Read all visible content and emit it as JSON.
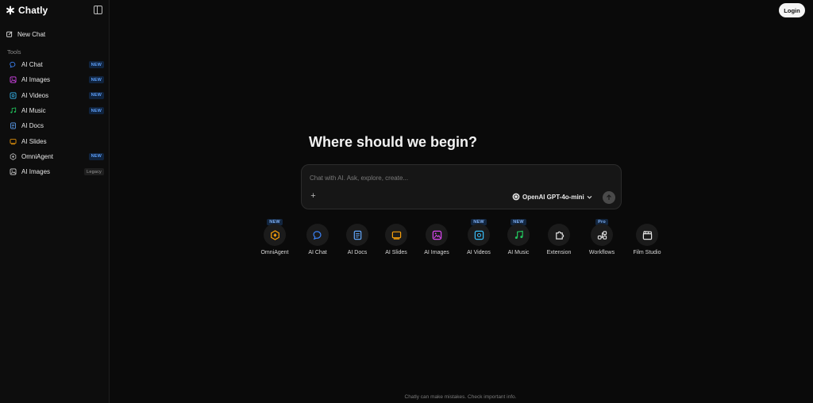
{
  "brand": {
    "name": "Chatly"
  },
  "sidebar": {
    "new_chat": "New Chat",
    "tools_heading": "Tools",
    "items": [
      {
        "label": "AI Chat",
        "badge": "NEW",
        "icon": "chat-bubble-icon",
        "color": "#3b82f6"
      },
      {
        "label": "AI Images",
        "badge": "NEW",
        "icon": "image-icon",
        "color": "#d946ef"
      },
      {
        "label": "AI Videos",
        "badge": "NEW",
        "icon": "video-icon",
        "color": "#38bdf8"
      },
      {
        "label": "AI Music",
        "badge": "NEW",
        "icon": "music-icon",
        "color": "#22c55e"
      },
      {
        "label": "AI Docs",
        "badge": "",
        "icon": "document-icon",
        "color": "#60a5fa"
      },
      {
        "label": "AI Slides",
        "badge": "",
        "icon": "slides-icon",
        "color": "#f59e0b"
      },
      {
        "label": "OmniAgent",
        "badge": "NEW",
        "icon": "omniagent-icon",
        "color": "#bdbdbd"
      },
      {
        "label": "AI Images",
        "badge": "Legacy",
        "icon": "image-legacy-icon",
        "color": "#cfcfcf"
      }
    ]
  },
  "header": {
    "login": "Login"
  },
  "main": {
    "heading": "Where should we begin?",
    "input_placeholder": "Chat with AI. Ask, explore, create...",
    "model": "OpenAI GPT-4o-mini"
  },
  "quick_actions": [
    {
      "label": "OmniAgent",
      "badge": "NEW",
      "icon": "omniagent-icon",
      "color": "#f59e0b"
    },
    {
      "label": "AI Chat",
      "badge": "",
      "icon": "chat-bubble-icon",
      "color": "#3b82f6"
    },
    {
      "label": "AI Docs",
      "badge": "",
      "icon": "document-icon",
      "color": "#60a5fa"
    },
    {
      "label": "AI Slides",
      "badge": "",
      "icon": "slides-icon",
      "color": "#f59e0b"
    },
    {
      "label": "AI Images",
      "badge": "",
      "icon": "image-icon",
      "color": "#d946ef"
    },
    {
      "label": "AI Videos",
      "badge": "NEW",
      "icon": "video-icon",
      "color": "#38bdf8"
    },
    {
      "label": "AI Music",
      "badge": "NEW",
      "icon": "music-icon",
      "color": "#22c55e"
    },
    {
      "label": "Extension",
      "badge": "",
      "icon": "puzzle-icon",
      "color": "#e5e5e5"
    },
    {
      "label": "Workflows",
      "badge": "Pro",
      "icon": "workflow-icon",
      "color": "#e5e5e5"
    },
    {
      "label": "Film Studio",
      "badge": "",
      "icon": "clapperboard-icon",
      "color": "#e5e5e5"
    }
  ],
  "footer": {
    "disclaimer": "Chatly can make mistakes. Check important info."
  }
}
